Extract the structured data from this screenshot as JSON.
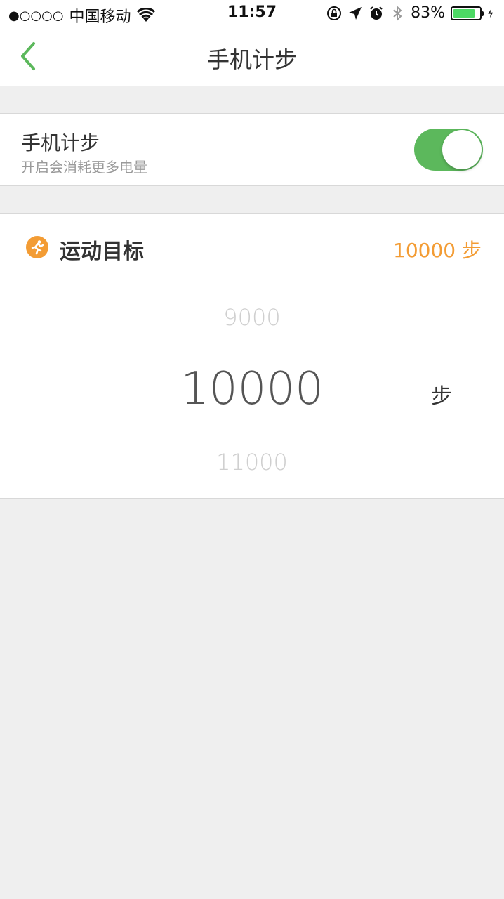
{
  "status_bar": {
    "signal": "●○○○○",
    "carrier": "中国移动",
    "time": "11:57",
    "battery_pct": "83%",
    "battery_level": 0.83,
    "icons": [
      "wifi-icon",
      "rotation-lock-icon",
      "location-icon",
      "alarm-icon",
      "bluetooth-icon",
      "charging-icon"
    ]
  },
  "nav": {
    "title": "手机计步",
    "back_icon": "chevron-left-icon",
    "accent": "#5cb85c"
  },
  "step_counter": {
    "title": "手机计步",
    "subtitle": "开启会消耗更多电量",
    "enabled": true,
    "toggle_color": "#5cb85c"
  },
  "goal": {
    "label": "运动目标",
    "value": "10000 步",
    "icon": "running-person-icon",
    "accent": "#f39c34"
  },
  "picker": {
    "prev": "9000",
    "current": "10000",
    "next": "11000",
    "unit": "步"
  }
}
